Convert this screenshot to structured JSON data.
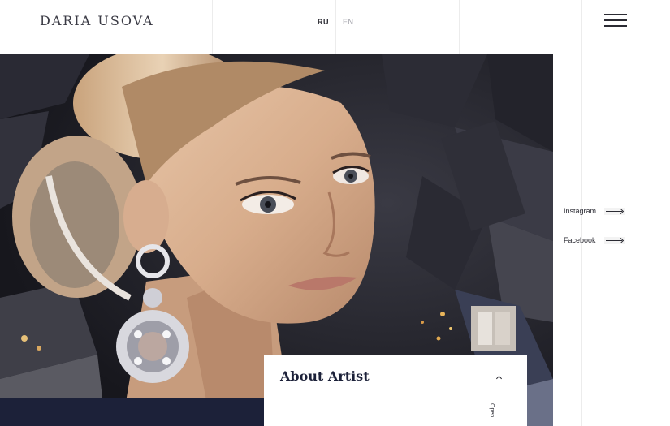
{
  "header": {
    "logo": "DARIA  USOVA",
    "languages": [
      {
        "label": "RU",
        "active": true
      },
      {
        "label": "EN",
        "active": false
      }
    ],
    "menu_icon": "hamburger-menu-icon"
  },
  "hero": {
    "alt": "Collage portrait of a woman with a jeweled earring"
  },
  "social": {
    "instagram_label": "Instagram",
    "facebook_label": "Facebook",
    "arrow_icon": "arrow-right-icon"
  },
  "about": {
    "title": "About Artist",
    "open_label": "Open",
    "arrow_icon": "arrow-up-icon"
  },
  "colors": {
    "navy": "#1c2139",
    "text": "#2b2b33",
    "muted": "#a0a0a8"
  }
}
